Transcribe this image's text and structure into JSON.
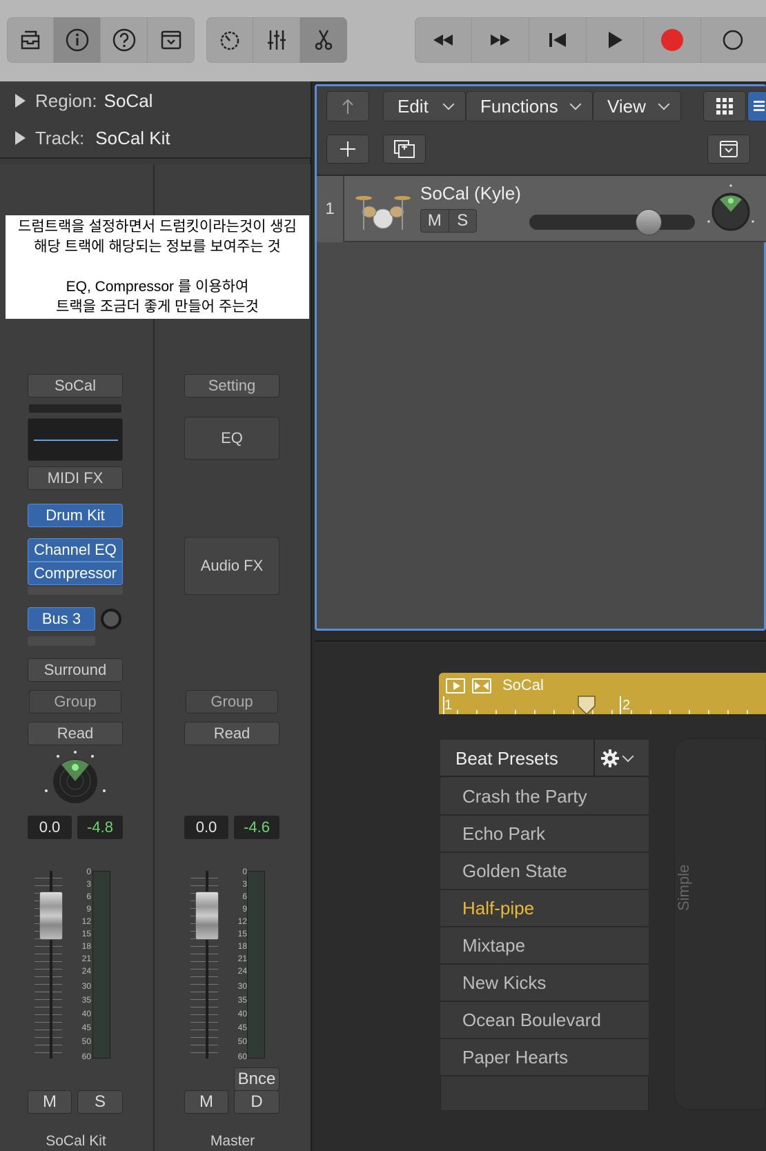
{
  "toolbar": {
    "view_buttons": [
      "library-icon",
      "info-icon",
      "help-icon",
      "browser-icon"
    ],
    "edit_buttons": [
      "smart-controls-icon",
      "mixer-icon",
      "scissors-icon"
    ],
    "transport": [
      "rewind-icon",
      "fast-forward-icon",
      "go-to-start-icon",
      "play-icon",
      "record-icon"
    ]
  },
  "inspector": {
    "region_label": "Region:",
    "region_value": "SoCal",
    "track_label": "Track:",
    "track_value": "SoCal Kit"
  },
  "note": {
    "line1": "드럼트랙을 설정하면서 드럼킷이라는것이 생김",
    "line2": "해당 트랙에 해당되는 정보를 보여주는 것",
    "line3": "EQ, Compressor 를 이용하여",
    "line4": "트랙을 조금더 좋게 만들어 주는것"
  },
  "strip_left": {
    "setting": "SoCal",
    "midi_fx": "MIDI FX",
    "instrument": "Drum Kit",
    "fx1": "Channel EQ",
    "fx2": "Compressor",
    "send": "Bus 3",
    "output": "Surround",
    "group": "Group",
    "automation": "Read",
    "volume": "0.0",
    "peak": "-4.8",
    "mute": "M",
    "solo": "S",
    "name": "SoCal Kit"
  },
  "strip_right": {
    "setting": "Setting",
    "eq": "EQ",
    "audio_fx": "Audio FX",
    "group": "Group",
    "automation": "Read",
    "volume": "0.0",
    "peak": "-4.6",
    "bounce": "Bnce",
    "mute": "M",
    "dim": "D",
    "name": "Master"
  },
  "meter_scale": [
    "0",
    "3",
    "6",
    "9",
    "12",
    "15",
    "18",
    "21",
    "24",
    "30",
    "35",
    "40",
    "45",
    "50",
    "60"
  ],
  "tracks_header": {
    "edit": "Edit",
    "functions": "Functions",
    "view": "View"
  },
  "track": {
    "number": "1",
    "name": "SoCal (Kyle)",
    "mute": "M",
    "solo": "S"
  },
  "region": {
    "name": "SoCal",
    "bar1": "1",
    "bar2": "2"
  },
  "beat_presets": {
    "title": "Beat Presets",
    "items": [
      "Crash the Party",
      "Echo Park",
      "Golden State",
      "Half-pipe",
      "Mixtape",
      "New Kicks",
      "Ocean Boulevard",
      "Paper Hearts"
    ],
    "selected": "Half-pipe"
  },
  "side_panel_label": "Simple",
  "colors": {
    "accent_blue": "#3566a9",
    "region_yellow": "#c9a63a",
    "selected_preset": "#e9b93a",
    "read_green": "#6fd46f",
    "record_red": "#e02a2a"
  }
}
